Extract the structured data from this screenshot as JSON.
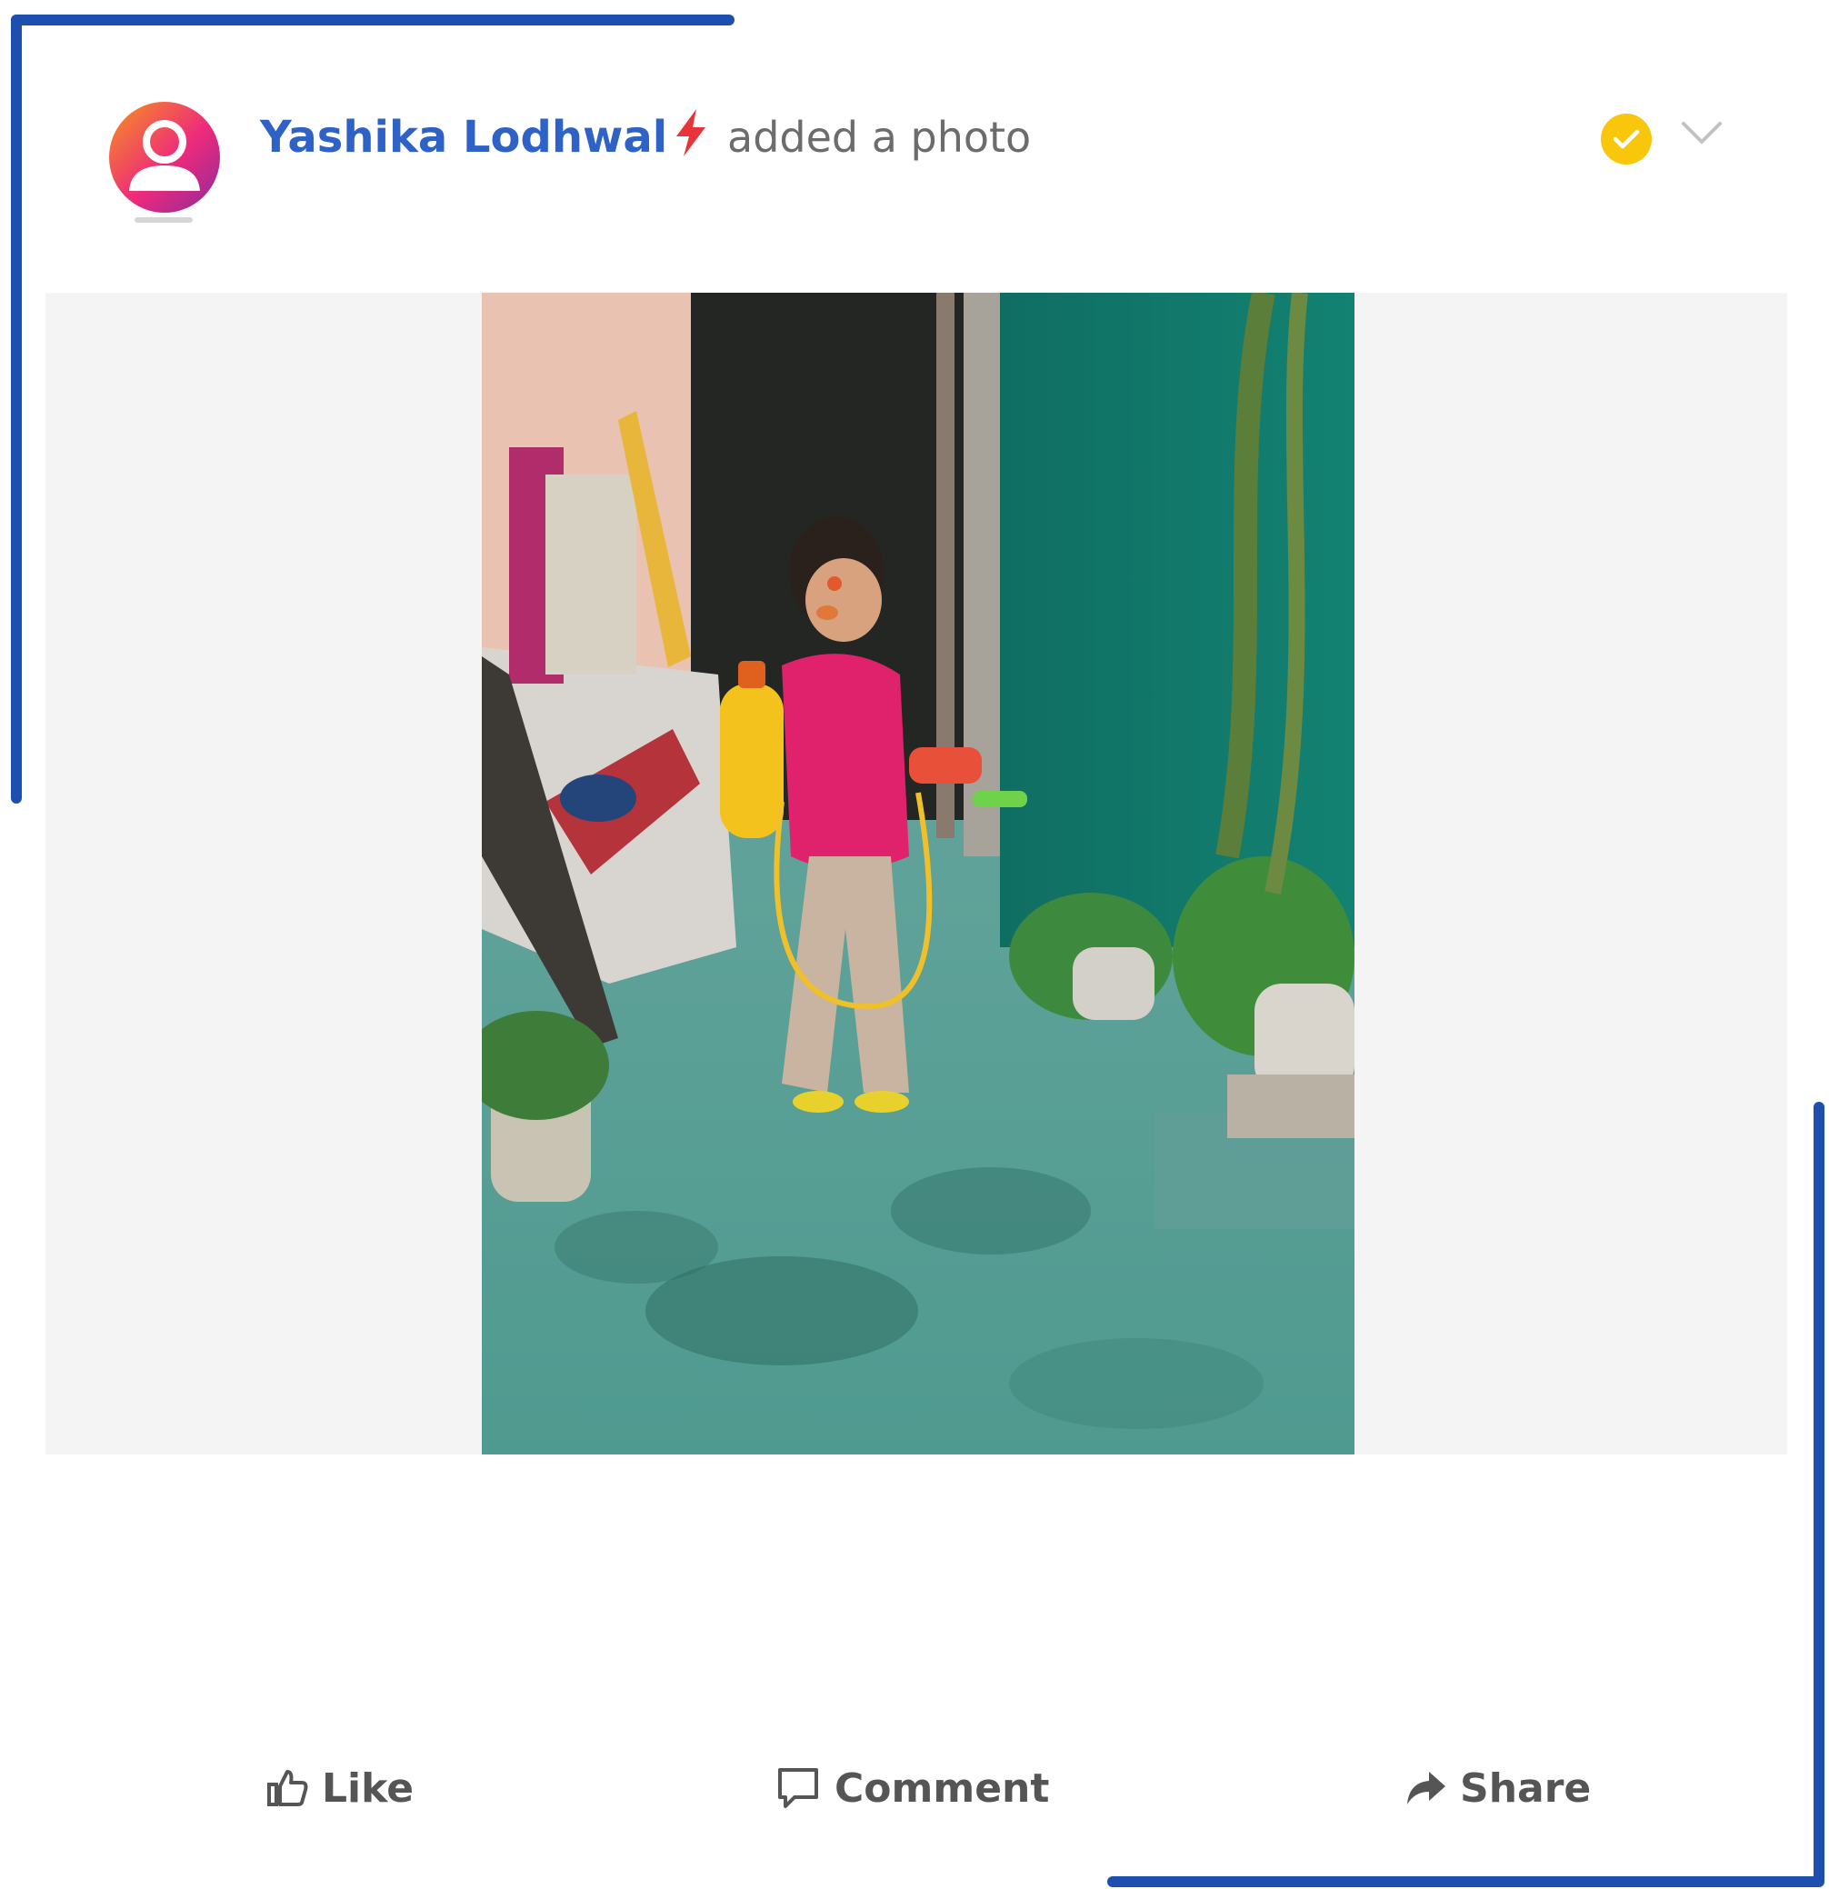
{
  "post": {
    "author_name": "Yashika Lodhwal",
    "action_text": "added a photo",
    "badge_icon": "lightning-bolt-icon",
    "status_icon": "verified-check-icon",
    "menu_icon": "chevron-down-icon"
  },
  "actions": {
    "like_label": "Like",
    "comment_label": "Comment",
    "share_label": "Share"
  },
  "colors": {
    "frame": "#1d4fae",
    "author_name": "#2f62c7",
    "bolt": "#e8333a",
    "verified": "#f8c70c"
  }
}
